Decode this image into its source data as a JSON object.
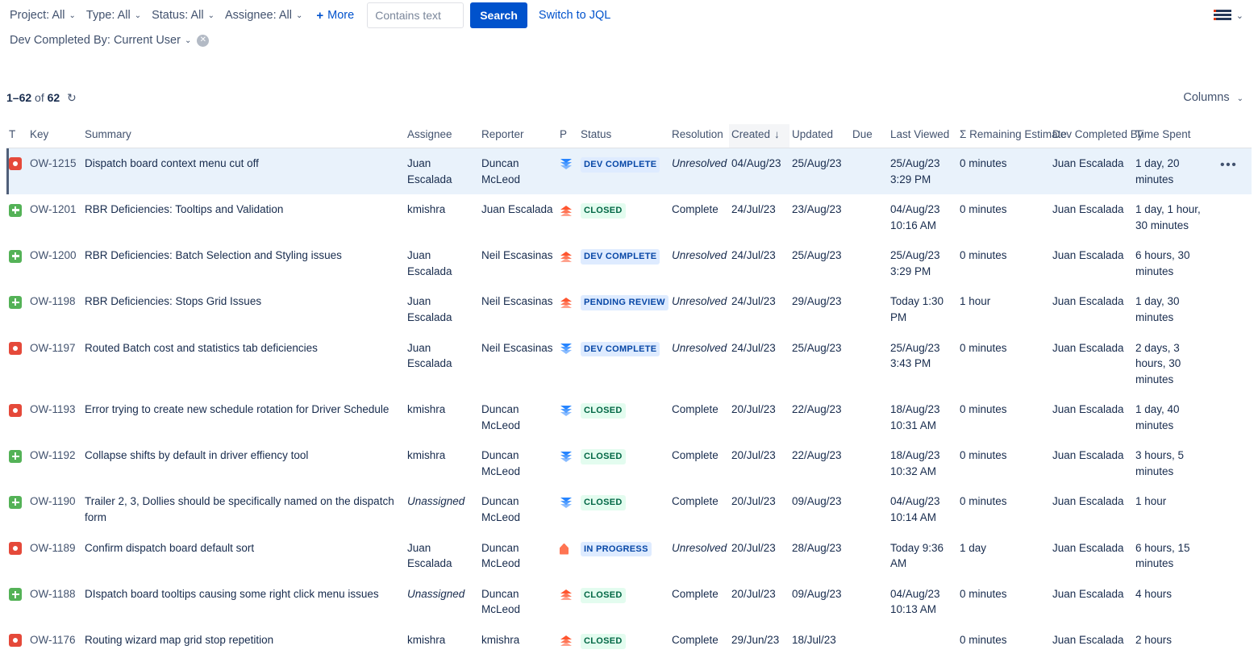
{
  "filters": {
    "pills": [
      {
        "label": "Project: All",
        "name": "filter-project"
      },
      {
        "label": "Type: All",
        "name": "filter-type"
      },
      {
        "label": "Status: All",
        "name": "filter-status"
      },
      {
        "label": "Assignee: All",
        "name": "filter-assignee"
      }
    ],
    "more_label": "More",
    "more_plus": "+",
    "caret": "⌄",
    "second_row_pill": "Dev Completed By: Current User",
    "clear_icon": "✕"
  },
  "search": {
    "placeholder": "Contains text",
    "value": "",
    "button_label": "Search",
    "jql_link": "Switch to JQL"
  },
  "topbar": {
    "menu_icon": "hamburger-icon",
    "menu_caret": "⌄"
  },
  "results": {
    "range": "1–62",
    "of_text": "of",
    "total": "62",
    "refresh_icon": "↺",
    "columns_label": "Columns",
    "columns_caret": "⌄"
  },
  "table": {
    "columns": [
      {
        "key": "t",
        "label": "T"
      },
      {
        "key": "key",
        "label": "Key"
      },
      {
        "key": "summary",
        "label": "Summary"
      },
      {
        "key": "assignee",
        "label": "Assignee"
      },
      {
        "key": "reporter",
        "label": "Reporter"
      },
      {
        "key": "p",
        "label": "P"
      },
      {
        "key": "status",
        "label": "Status"
      },
      {
        "key": "resolution",
        "label": "Resolution"
      },
      {
        "key": "created",
        "label": "Created"
      },
      {
        "key": "updated",
        "label": "Updated"
      },
      {
        "key": "due",
        "label": "Due"
      },
      {
        "key": "last_viewed",
        "label": "Last Viewed"
      },
      {
        "key": "remaining",
        "label": "Σ Remaining Estimate"
      },
      {
        "key": "dev_completed_by",
        "label": "Dev Completed By"
      },
      {
        "key": "time_spent",
        "label": "Time Spent"
      }
    ],
    "sorted_column": "created",
    "sort_arrow": "↓",
    "rows": [
      {
        "selected": true,
        "type": "bug",
        "key": "OW-1215",
        "summary": "Dispatch board context menu cut off",
        "assignee": "Juan Escalada",
        "reporter": "Duncan McLeod",
        "priority": "low",
        "status": "DEV COMPLETE",
        "status_style": "blue",
        "resolution": "Unresolved",
        "resolution_italic": true,
        "created": "04/Aug/23",
        "updated": "25/Aug/23",
        "due": "",
        "last_viewed": "25/Aug/23 3:29 PM",
        "remaining": "0 minutes",
        "dev_completed_by": "Juan Escalada",
        "time_spent": "1 day, 20 minutes",
        "actions": "•••"
      },
      {
        "selected": false,
        "type": "feature",
        "key": "OW-1201",
        "summary": "RBR Deficiencies: Tooltips and Validation",
        "assignee": "kmishra",
        "reporter": "Juan Escalada",
        "priority": "high",
        "status": "CLOSED",
        "status_style": "green",
        "resolution": "Complete",
        "resolution_italic": false,
        "created": "24/Jul/23",
        "updated": "23/Aug/23",
        "due": "",
        "last_viewed": "04/Aug/23 10:16 AM",
        "remaining": "0 minutes",
        "dev_completed_by": "Juan Escalada",
        "time_spent": "1 day, 1 hour, 30 minutes",
        "actions": ""
      },
      {
        "selected": false,
        "type": "feature",
        "key": "OW-1200",
        "summary": "RBR Deficiencies: Batch Selection and Styling issues",
        "assignee": "Juan Escalada",
        "reporter": "Neil Escasinas",
        "priority": "high",
        "status": "DEV COMPLETE",
        "status_style": "blue",
        "resolution": "Unresolved",
        "resolution_italic": true,
        "created": "24/Jul/23",
        "updated": "25/Aug/23",
        "due": "",
        "last_viewed": "25/Aug/23 3:29 PM",
        "remaining": "0 minutes",
        "dev_completed_by": "Juan Escalada",
        "time_spent": "6 hours, 30 minutes",
        "actions": ""
      },
      {
        "selected": false,
        "type": "feature",
        "key": "OW-1198",
        "summary": "RBR Deficiencies: Stops Grid Issues",
        "assignee": "Juan Escalada",
        "reporter": "Neil Escasinas",
        "priority": "high",
        "status": "PENDING REVIEW",
        "status_style": "blue",
        "resolution": "Unresolved",
        "resolution_italic": true,
        "created": "24/Jul/23",
        "updated": "29/Aug/23",
        "due": "",
        "last_viewed": "Today 1:30 PM",
        "remaining": "1 hour",
        "dev_completed_by": "Juan Escalada",
        "time_spent": "1 day, 30 minutes",
        "actions": ""
      },
      {
        "selected": false,
        "type": "bug",
        "key": "OW-1197",
        "summary": "Routed Batch cost and statistics tab deficiencies",
        "assignee": "Juan Escalada",
        "reporter": "Neil Escasinas",
        "priority": "low",
        "status": "DEV COMPLETE",
        "status_style": "blue",
        "resolution": "Unresolved",
        "resolution_italic": true,
        "created": "24/Jul/23",
        "updated": "25/Aug/23",
        "due": "",
        "last_viewed": "25/Aug/23 3:43 PM",
        "remaining": "0 minutes",
        "dev_completed_by": "Juan Escalada",
        "time_spent": "2 days, 3 hours, 30 minutes",
        "actions": ""
      },
      {
        "selected": false,
        "type": "bug",
        "key": "OW-1193",
        "summary": "Error trying to create new schedule rotation for Driver Schedule",
        "assignee": "kmishra",
        "reporter": "Duncan McLeod",
        "priority": "low",
        "status": "CLOSED",
        "status_style": "green",
        "resolution": "Complete",
        "resolution_italic": false,
        "created": "20/Jul/23",
        "updated": "22/Aug/23",
        "due": "",
        "last_viewed": "18/Aug/23 10:31 AM",
        "remaining": "0 minutes",
        "dev_completed_by": "Juan Escalada",
        "time_spent": "1 day, 40 minutes",
        "actions": ""
      },
      {
        "selected": false,
        "type": "feature",
        "key": "OW-1192",
        "summary": "Collapse shifts by default in driver effiency tool",
        "assignee": "kmishra",
        "reporter": "Duncan McLeod",
        "priority": "low",
        "status": "CLOSED",
        "status_style": "green",
        "resolution": "Complete",
        "resolution_italic": false,
        "created": "20/Jul/23",
        "updated": "22/Aug/23",
        "due": "",
        "last_viewed": "18/Aug/23 10:32 AM",
        "remaining": "0 minutes",
        "dev_completed_by": "Juan Escalada",
        "time_spent": "3 hours, 5 minutes",
        "actions": ""
      },
      {
        "selected": false,
        "type": "feature",
        "key": "OW-1190",
        "summary": "Trailer 2, 3, Dollies should be specifically named on the dispatch form",
        "assignee": "Unassigned",
        "assignee_italic": true,
        "reporter": "Duncan McLeod",
        "priority": "low",
        "status": "CLOSED",
        "status_style": "green",
        "resolution": "Complete",
        "resolution_italic": false,
        "created": "20/Jul/23",
        "updated": "09/Aug/23",
        "due": "",
        "last_viewed": "04/Aug/23 10:14 AM",
        "remaining": "0 minutes",
        "dev_completed_by": "Juan Escalada",
        "time_spent": "1 hour",
        "actions": ""
      },
      {
        "selected": false,
        "type": "bug",
        "key": "OW-1189",
        "summary": "Confirm dispatch board default sort",
        "assignee": "Juan Escalada",
        "reporter": "Duncan McLeod",
        "priority": "critical",
        "status": "IN PROGRESS",
        "status_style": "blue",
        "resolution": "Unresolved",
        "resolution_italic": true,
        "created": "20/Jul/23",
        "updated": "28/Aug/23",
        "due": "",
        "last_viewed": "Today 9:36 AM",
        "remaining": "1 day",
        "dev_completed_by": "Juan Escalada",
        "time_spent": "6 hours, 15 minutes",
        "actions": ""
      },
      {
        "selected": false,
        "type": "feature",
        "key": "OW-1188",
        "summary": "DIspatch board tooltips causing some right click menu issues",
        "assignee": "Unassigned",
        "assignee_italic": true,
        "reporter": "Duncan McLeod",
        "priority": "high",
        "status": "CLOSED",
        "status_style": "green",
        "resolution": "Complete",
        "resolution_italic": false,
        "created": "20/Jul/23",
        "updated": "09/Aug/23",
        "due": "",
        "last_viewed": "04/Aug/23 10:13 AM",
        "remaining": "0 minutes",
        "dev_completed_by": "Juan Escalada",
        "time_spent": "4 hours",
        "actions": ""
      },
      {
        "selected": false,
        "type": "bug",
        "key": "OW-1176",
        "summary": "Routing wizard map grid stop repetition",
        "assignee": "kmishra",
        "reporter": "kmishra",
        "priority": "high",
        "status": "CLOSED",
        "status_style": "green",
        "resolution": "Complete",
        "resolution_italic": false,
        "created": "29/Jun/23",
        "updated": "18/Jul/23",
        "due": "",
        "last_viewed": "",
        "remaining": "0 minutes",
        "dev_completed_by": "Juan Escalada",
        "time_spent": "2 hours",
        "actions": ""
      }
    ]
  },
  "colors": {
    "accent": "#0052cc",
    "bug": "#e5493a",
    "feature": "#54b257",
    "priority_low": "#2684ff",
    "priority_high": "#ff5630",
    "priority_critical": "#ff7452",
    "selected_row": "#e9f2fb"
  }
}
